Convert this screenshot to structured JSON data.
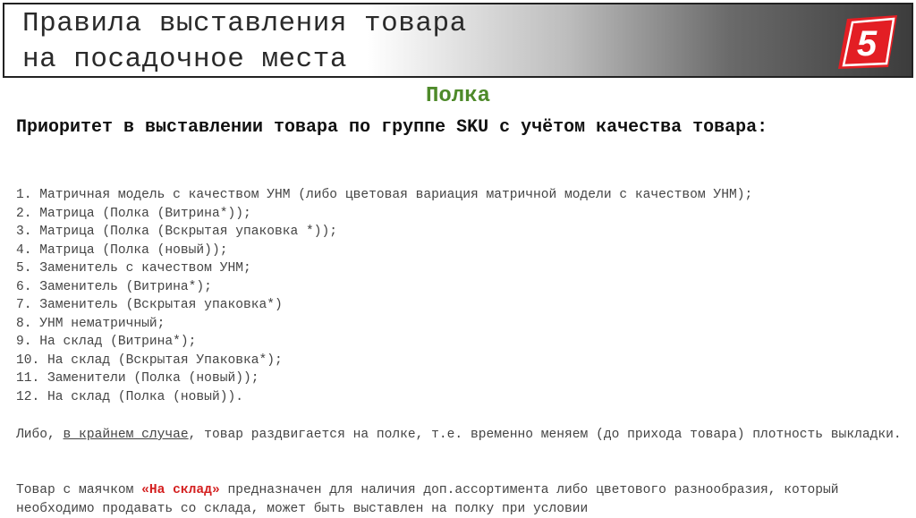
{
  "header": {
    "title_line1": "Правила выставления товара",
    "title_line2": "на посадочное места"
  },
  "logo": {
    "glyph": "5",
    "color": "#e31e24"
  },
  "section_heading": "Полка",
  "priority_heading": "Приоритет в выставлении товара  по группе SKU с учётом качества товара:",
  "priority_list": [
    "1. Матричная модель с качеством УНМ (либо цветовая вариация матричной модели с качеством УНМ);",
    "2. Матрица (Полка (Витрина*));",
    "3. Матрица (Полка (Вскрытая упаковка *));",
    "4. Матрица (Полка (новый));",
    "5. Заменитель с качеством УНМ;",
    "6. Заменитель (Витрина*);",
    "7. Заменитель (Вскрытая упаковка*)",
    "8. УНМ нематричный;",
    "9. На склад (Витрина*);",
    "10. На склад (Вскрытая Упаковка*);",
    "11. Заменители (Полка (новый));",
    "12. На склад (Полка (новый))."
  ],
  "paragraph1": {
    "before": "Либо, ",
    "underlined": "в крайнем случае",
    "after": ", товар раздвигается на полке, т.е. временно меняем (до прихода товара) плотность выкладки."
  },
  "paragraph2": {
    "before": "Товар с маячком ",
    "highlight": "«На склад»",
    "after": " предназначен для наличия доп.ассортимента либо цветового разнообразия, который необходимо продавать со склада, может быть выставлен на полку при условии"
  }
}
